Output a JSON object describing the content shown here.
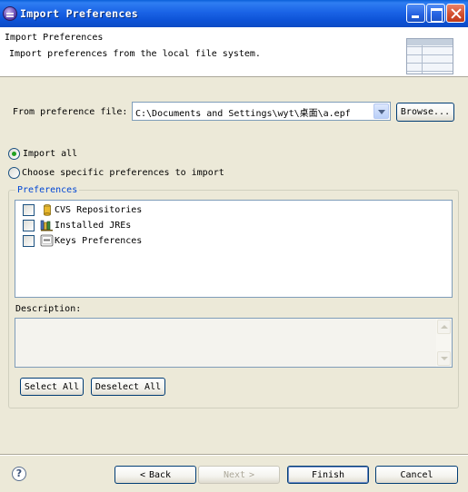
{
  "window": {
    "title": "Import Preferences"
  },
  "header": {
    "title": "Import Preferences",
    "description": "Import preferences from the local file system."
  },
  "form": {
    "from_label": "From preference file:",
    "file_path": "C:\\Documents and Settings\\wyt\\桌面\\a.epf",
    "browse_label": "Browse..."
  },
  "options": [
    {
      "label": "Import all",
      "selected": true
    },
    {
      "label": "Choose specific preferences to import",
      "selected": false
    }
  ],
  "preferences": {
    "group_label": "Preferences",
    "items": [
      {
        "label": "CVS Repositories",
        "checked": false,
        "icon": "cvs-repository-icon"
      },
      {
        "label": "Installed JREs",
        "checked": false,
        "icon": "jre-library-icon"
      },
      {
        "label": "Keys Preferences",
        "checked": false,
        "icon": "keyboard-key-icon"
      }
    ],
    "description_label": "Description:",
    "description_text": "",
    "select_all_label": "Select All",
    "deselect_all_label": "Deselect All"
  },
  "footer": {
    "back_label": "Back",
    "next_label": "Next",
    "finish_label": "Finish",
    "cancel_label": "Cancel"
  }
}
